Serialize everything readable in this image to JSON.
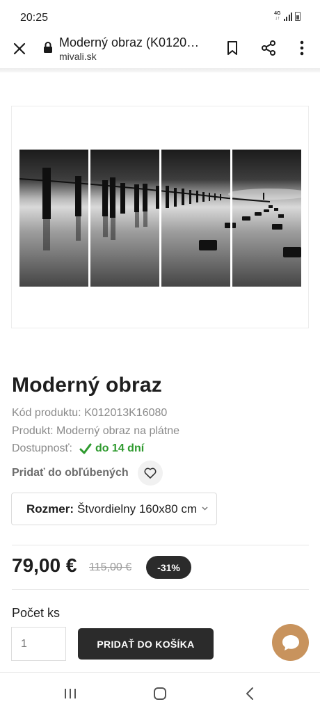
{
  "status_bar": {
    "time": "20:25",
    "network": "4G"
  },
  "browser": {
    "page_title": "Moderný obraz (K01201…",
    "domain": "mivali.sk",
    "icons": [
      "close-icon",
      "lock-icon",
      "bookmark-icon",
      "share-icon",
      "more-vert-icon"
    ]
  },
  "product": {
    "image_description_icon": "four-panel-canvas-image",
    "title": "Moderný obraz",
    "code_line": "Kód produktu: K012013K16080",
    "product_line": "Produkt: Moderný obraz na plátne",
    "availability_label": "Dostupnosť:",
    "availability_value": "do 14 dní",
    "favorite_label": "Pridať do obľúbených",
    "variant": {
      "label": "Rozmer:",
      "value": "Štvordielny 160x80 cm"
    },
    "price": "79,00 €",
    "old_price": "115,00 €",
    "discount": "-31%",
    "quantity_label": "Počet ks",
    "quantity_value": "1",
    "add_to_cart_label": "PRIDAŤ DO KOŠÍKA"
  },
  "colors": {
    "accent_dark": "#2b2b2b",
    "availability_green": "#2e9a2e",
    "chat_button": "#c8935d"
  },
  "nav_bar": {
    "icons": [
      "recent-apps-icon",
      "home-icon",
      "back-icon"
    ]
  }
}
